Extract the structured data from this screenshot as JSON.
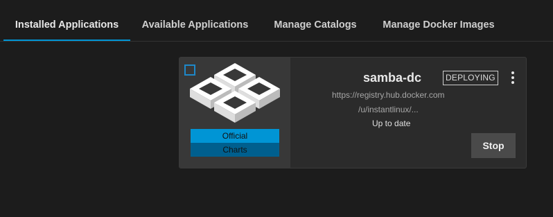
{
  "tabs": [
    {
      "label": "Installed Applications",
      "active": true
    },
    {
      "label": "Available Applications",
      "active": false
    },
    {
      "label": "Manage Catalogs",
      "active": false
    },
    {
      "label": "Manage Docker Images",
      "active": false
    }
  ],
  "accent_color": "#0095d5",
  "app_card": {
    "name": "samba-dc",
    "status": "DEPLOYING",
    "image_url_line1": "https://registry.hub.docker.com",
    "image_url_line2": "/u/instantlinux/...",
    "update_status": "Up to date",
    "stop_label": "Stop",
    "badges": [
      "Official",
      "Charts"
    ],
    "logo_icon": "docker-image-icon",
    "menu_icon": "more-vert-icon",
    "checkbox_checked": false
  }
}
